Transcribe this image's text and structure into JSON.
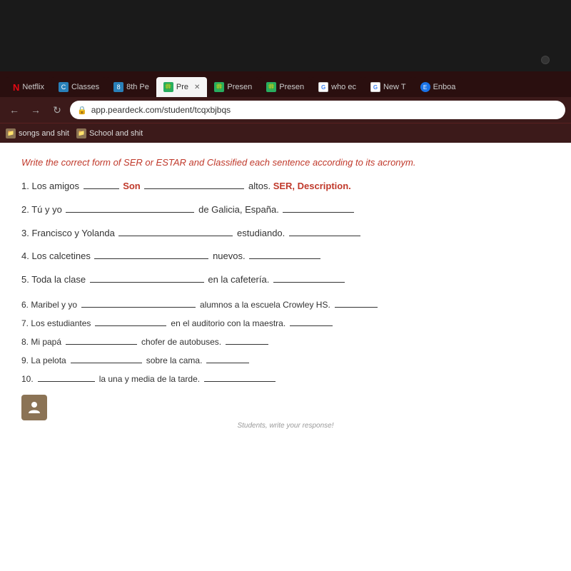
{
  "browser": {
    "tabs": [
      {
        "id": "netflix",
        "label": "Netflix",
        "icon": "N",
        "iconColor": "red",
        "active": false,
        "type": "netflix"
      },
      {
        "id": "classes",
        "label": "Classes",
        "icon": "C",
        "iconColor": "blue",
        "active": false
      },
      {
        "id": "8thper",
        "label": "8th Pe",
        "icon": "8",
        "iconColor": "blue",
        "active": false
      },
      {
        "id": "pre",
        "label": "Pre",
        "icon": "🍀",
        "iconColor": "green",
        "active": true
      },
      {
        "id": "present1",
        "label": "Presen",
        "icon": "🍀",
        "iconColor": "green",
        "active": false
      },
      {
        "id": "present2",
        "label": "Presen",
        "icon": "🍀",
        "iconColor": "green",
        "active": false
      },
      {
        "id": "who",
        "label": "who ec",
        "icon": "G",
        "iconColor": "google",
        "active": false
      },
      {
        "id": "newt",
        "label": "New T",
        "icon": "G",
        "iconColor": "google",
        "active": false
      },
      {
        "id": "enboa",
        "label": "Enboa",
        "icon": "E",
        "iconColor": "blue",
        "active": false
      }
    ],
    "url": "app.peardeck.com/student/tcqxbjbqs",
    "bookmarks": [
      {
        "id": "songs",
        "label": "songs and shit"
      },
      {
        "id": "school",
        "label": "School and shit"
      }
    ]
  },
  "page": {
    "instruction": "Write the correct form of SER or ESTAR and Classified each sentence according to its acronym.",
    "sentences": [
      {
        "num": "1",
        "prefix": "Los amigos",
        "blank1": "Son",
        "middle": "",
        "suffix": "altos.",
        "answer": "SER, Description.",
        "blank2": ""
      },
      {
        "num": "2",
        "prefix": "Tú y yo",
        "blank1": "",
        "middle": "de Galicia, España.",
        "blank2": ""
      },
      {
        "num": "3",
        "prefix": "Francisco y Yolanda",
        "blank1": "",
        "middle": "estudiando.",
        "blank2": ""
      },
      {
        "num": "4",
        "prefix": "Los calcetines",
        "blank1": "",
        "middle": "nuevos.",
        "blank2": ""
      },
      {
        "num": "5",
        "prefix": "Toda la clase",
        "blank1": "",
        "middle": "en la cafetería.",
        "blank2": ""
      }
    ],
    "sentences_compact": [
      {
        "num": "6",
        "text": "Maribel y yo",
        "blank1": "alumnos a la escuela Crowley HS.",
        "blank2": ""
      },
      {
        "num": "7",
        "text": "Los estudiantes",
        "blank1": "en el auditorio con la maestra.",
        "blank2": ""
      },
      {
        "num": "8",
        "text": "Mi papá",
        "blank1": "chofer de autobuses.",
        "blank2": ""
      },
      {
        "num": "9",
        "text": "La pelota",
        "blank1": "sobre la cama.",
        "blank2": ""
      },
      {
        "num": "10",
        "text": "",
        "blank1": "la una y media de la tarde.",
        "blank2": ""
      }
    ],
    "student_prompt": "Students, write your response!"
  }
}
